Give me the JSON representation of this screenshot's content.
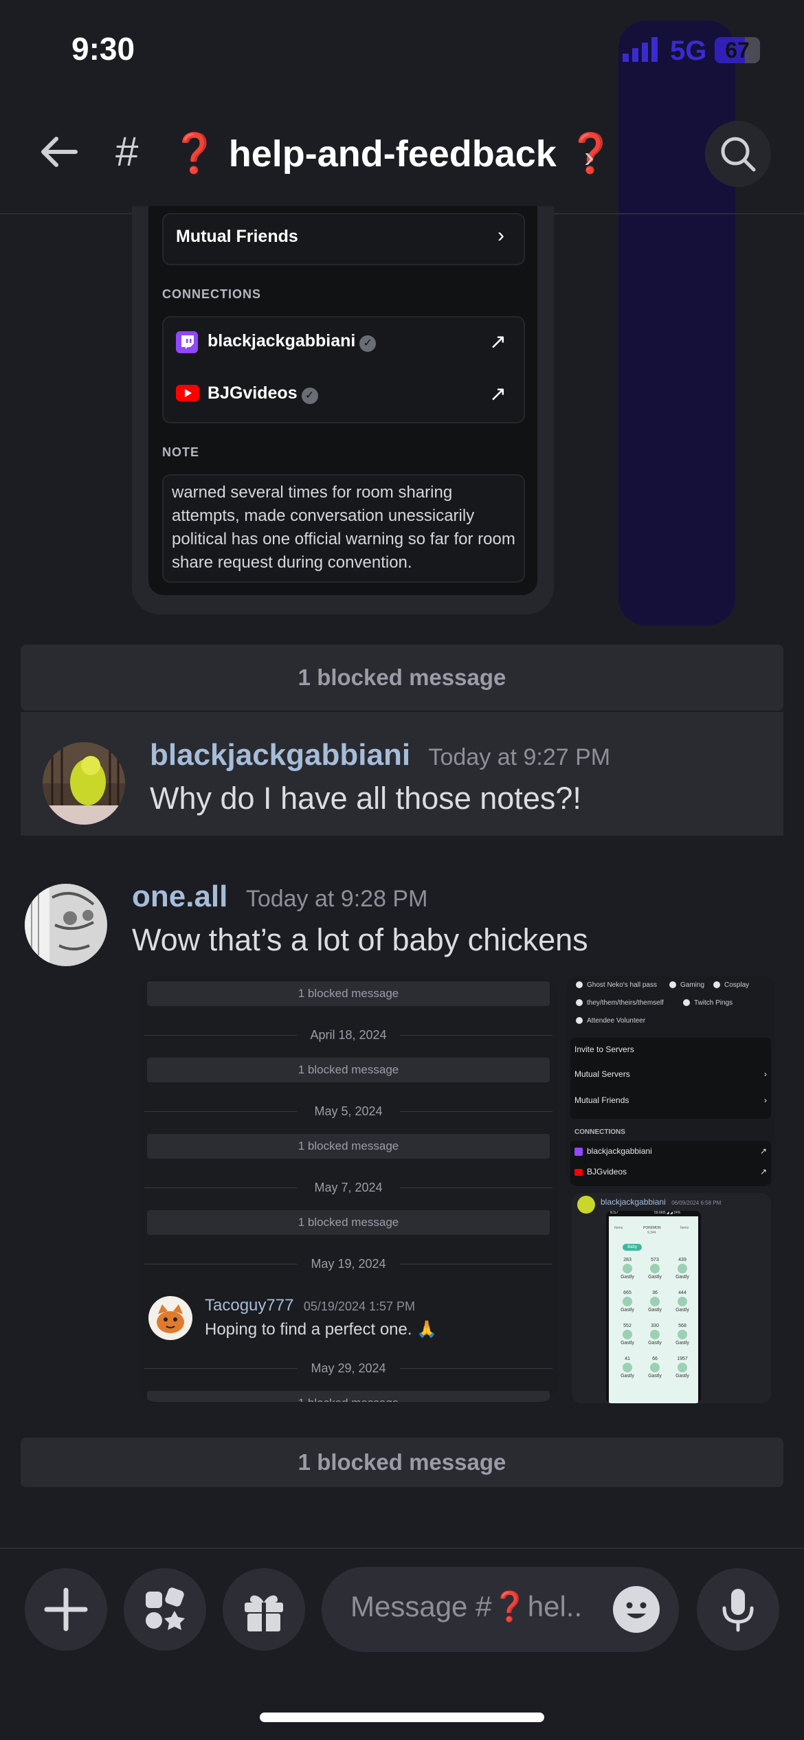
{
  "status_bar": {
    "time": "9:30",
    "network": "5G",
    "battery": "67",
    "battery_level": 0.67
  },
  "header": {
    "hash": "#",
    "channel_name": "help-and-feedback",
    "channel_emoji": "❓",
    "chevron": "›"
  },
  "profile_card": {
    "mutual_friends_label": "Mutual Friends",
    "connections_label": "CONNECTIONS",
    "connections": [
      {
        "service": "twitch",
        "name": "blackjackgabbiani"
      },
      {
        "service": "youtube",
        "name": "BJGvideos"
      }
    ],
    "note_label": "NOTE",
    "note_text": "warned several times for room sharing attempts, made conversation unessicarily political has one official warning so far for room share request during convention."
  },
  "messages": {
    "blocked_top": "1 blocked message",
    "msg1": {
      "author": "blackjackgabbiani",
      "timestamp": "Today at 9:27 PM",
      "text": "Why do I have all those notes?!"
    },
    "msg2": {
      "author": "one.all",
      "timestamp": "Today at 9:28 PM",
      "text": "Wow that’s a lot of baby chickens"
    },
    "blocked_bottom": "1 blocked message"
  },
  "attachment_chat": {
    "blocked": "1 blocked message",
    "dates": [
      "April 18, 2024",
      "May 5, 2024",
      "May 7, 2024",
      "May 19, 2024",
      "May 29, 2024"
    ],
    "post_author": "Tacoguy777",
    "post_time": "05/19/2024 1:57 PM",
    "post_text": "Hoping to find a perfect one. 🙏",
    "cut_text": "1 blocked message"
  },
  "attachment_profile": {
    "tags": [
      "Ghost Neko's hall pass",
      "Gaming",
      "Cosplay",
      "they/them/theirs/themself",
      "Twitch Pings",
      "Attendee Volunteer"
    ],
    "invite": "Invite to Servers",
    "mutual_servers": "Mutual Servers",
    "mutual_friends": "Mutual Friends",
    "connections_label": "CONNECTIONS",
    "conn1": "blackjackgabbiani",
    "conn2": "BJGvideos"
  },
  "attachment_post": {
    "author": "blackjackgabbiani",
    "time": "06/09/2024 6:58 PM",
    "phone_time": "6:57",
    "phone_status": "59.6KB ◢ ◢ 24%",
    "tabs": [
      "Items",
      "POKÉMON",
      "Items"
    ],
    "tab_sub": "9,344",
    "filter": "Baby",
    "values": [
      "283",
      "573",
      "439",
      "665",
      "36",
      "444",
      "552",
      "330",
      "568",
      "41",
      "66",
      "1957"
    ],
    "label": "Gastly"
  },
  "composer": {
    "placeholder_prefix": "Message #",
    "placeholder_suffix": "hel..",
    "emoji": "❓"
  },
  "icons": [
    "back-arrow-icon",
    "search-icon",
    "plus-icon",
    "apps-icon",
    "gift-icon",
    "emoji-icon",
    "mic-icon",
    "twitch-icon",
    "youtube-icon",
    "verified-icon",
    "external-link-icon",
    "chevron-right-icon"
  ],
  "colors": {
    "background": "#1c1d22",
    "username": "#a6bdd9",
    "twitch": "#9146ff",
    "youtube": "#ff0000",
    "alert": "#e03232"
  }
}
